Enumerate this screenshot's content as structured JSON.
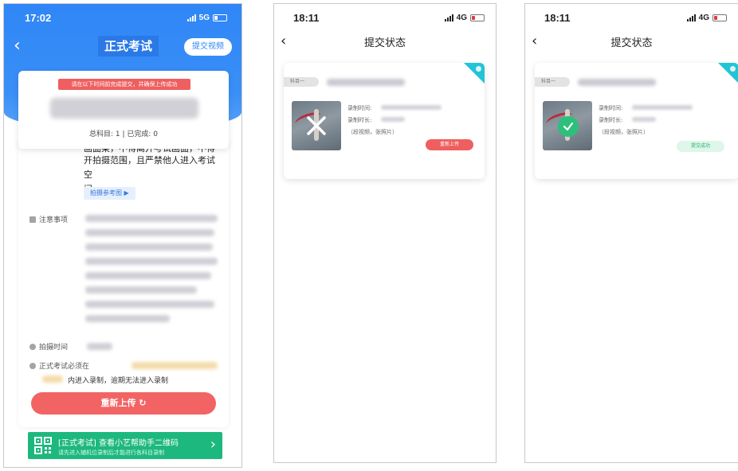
{
  "phone1": {
    "status": {
      "time": "17:02",
      "network": "5G"
    },
    "nav": {
      "back_glyph": "‹",
      "title": "正式考试",
      "submit_label": "提交视频"
    },
    "deadline_card": {
      "tip": "请在以下时间前完成提交，并确保上传成功",
      "stats": "总科目: 1 | 已完成: 0"
    },
    "content": {
      "line_partial": "画面架，不得离开考试画面，不得离",
      "line_1": "开拍摄范围，且严禁他人进入考试空",
      "line_2": "间。",
      "ref_button": "拍摄参考图 ▶",
      "notes_label": "注意事项",
      "shoot_time_label": "拍摄时间",
      "must_label": "正式考试必须在",
      "must_suffix": "内进入录制，逾期无法进入录制"
    },
    "reupload_button": "重新上传 ↻",
    "banner": {
      "title": "[正式考试] 查看小艺帮助手二维码",
      "subtitle": "请先进入辅机位录制后才能进行各科目录制",
      "arrow": "›"
    }
  },
  "phone2": {
    "status": {
      "time": "18:11",
      "network": "4G"
    },
    "nav": {
      "back_glyph": "‹",
      "title": "提交状态"
    },
    "card": {
      "subject_tag": "科目一",
      "rec_time_label": "录制时间:",
      "rec_duration_label": "录制时长:",
      "counts": "（段视频，张照片）",
      "action_button": "重新上传"
    }
  },
  "phone3": {
    "status": {
      "time": "18:11",
      "network": "4G"
    },
    "nav": {
      "back_glyph": "‹",
      "title": "提交状态"
    },
    "card": {
      "subject_tag": "科目一",
      "rec_time_label": "录制时间:",
      "rec_duration_label": "录制时长:",
      "counts": "（段视频，张照片）",
      "action_button": "提交成功"
    }
  },
  "colors": {
    "primary_blue": "#2f86f6",
    "danger_red": "#f26464",
    "success_green": "#2cc07a",
    "banner_green": "#1db87e",
    "corner_teal": "#23c4d6"
  }
}
